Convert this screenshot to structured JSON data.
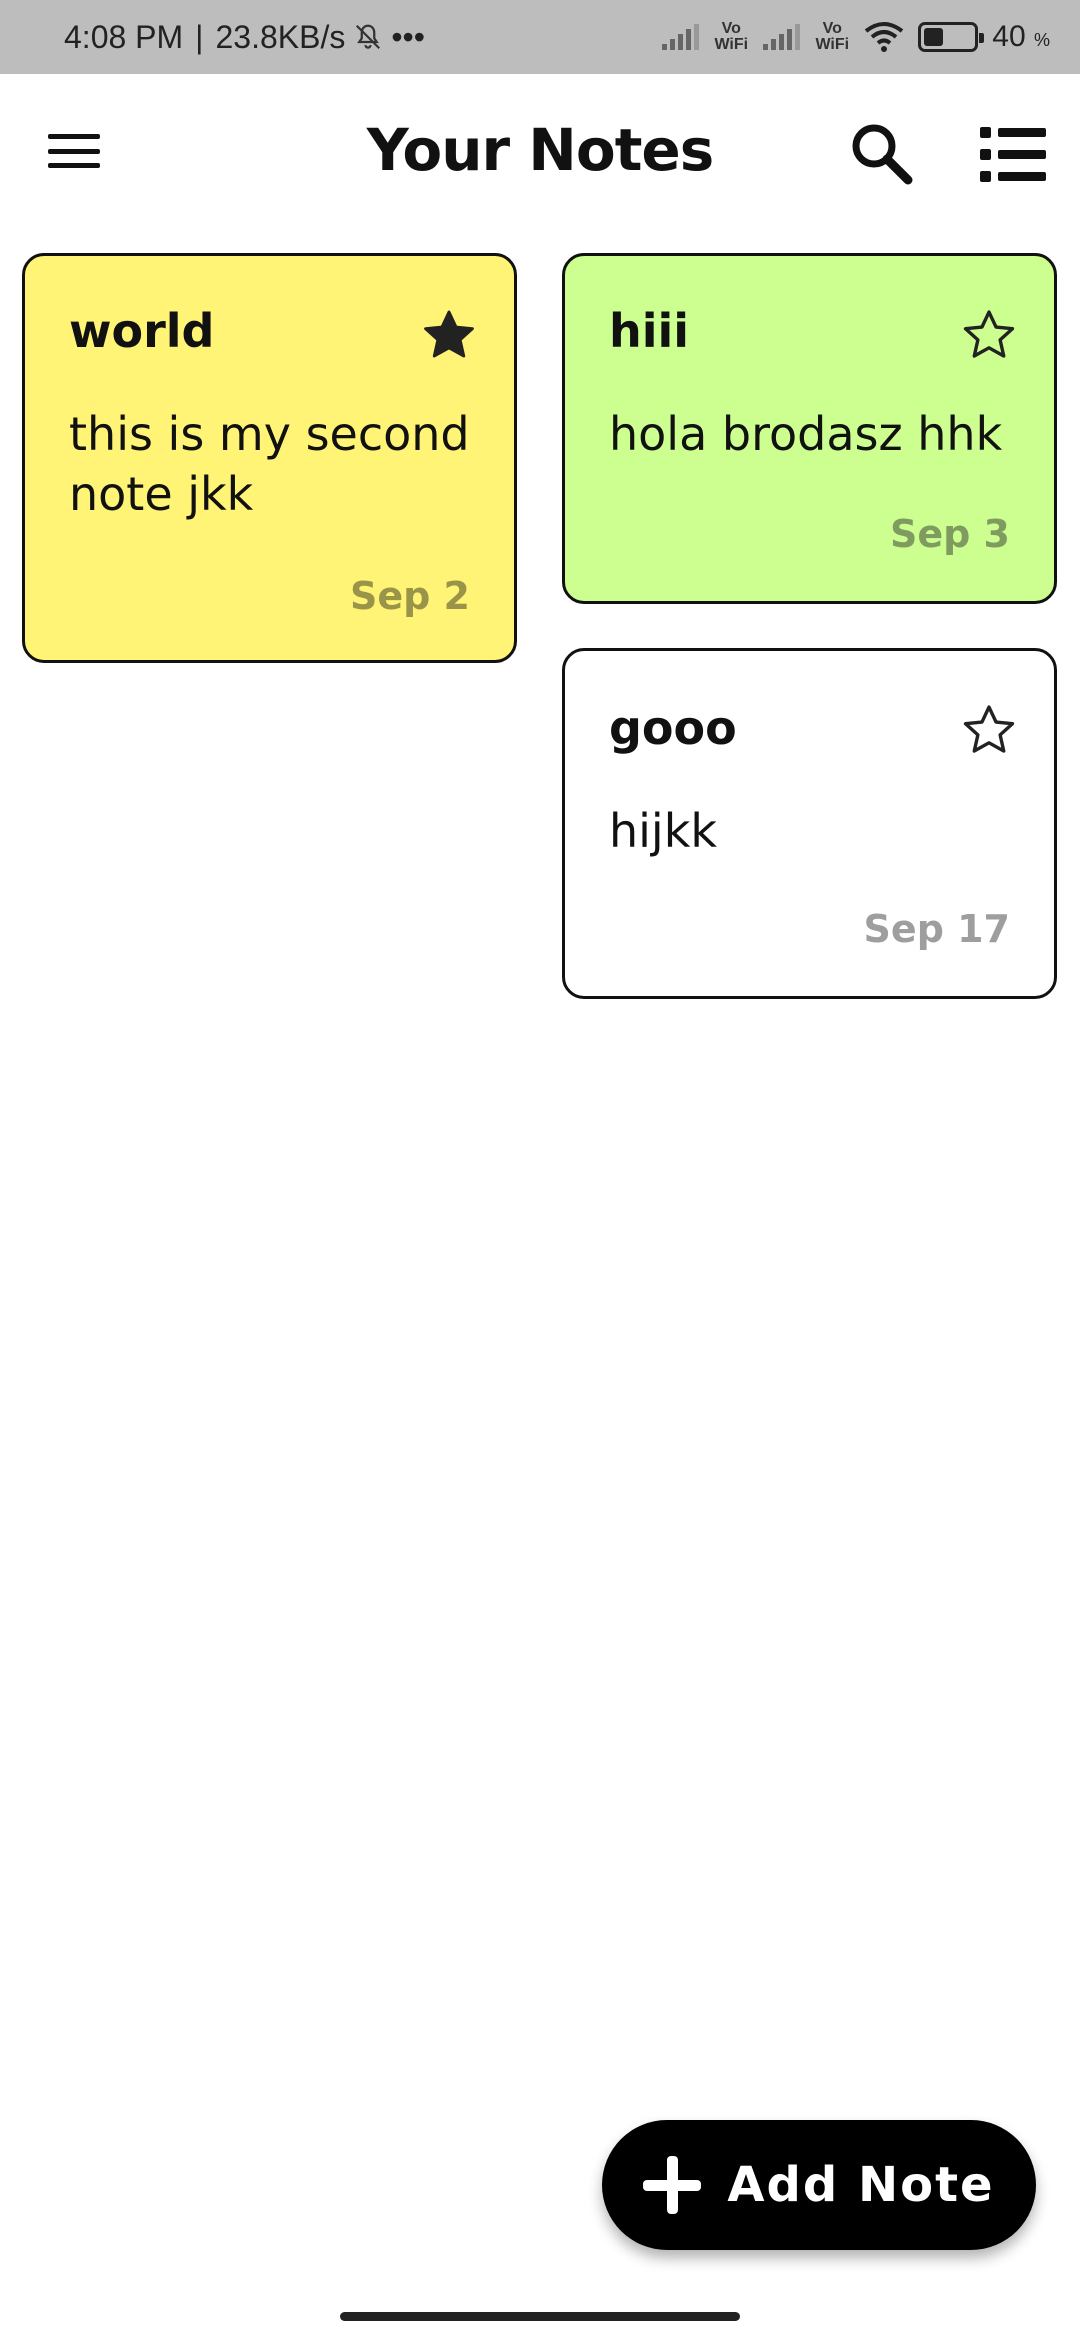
{
  "status_bar": {
    "time": "4:08 PM",
    "separator": "|",
    "net_speed": "23.8KB/s",
    "more": "•••",
    "vowifi_1": "Vo WiFi",
    "vowifi_2": "Vo WiFi",
    "battery_percent": "40",
    "percent_sign": "%",
    "battery_level": 0.4
  },
  "app_bar": {
    "title": "Your Notes",
    "menu_icon": "hamburger-menu-icon",
    "search_icon": "search-icon",
    "layout_icon": "list-view-icon"
  },
  "notes": [
    {
      "title": "world",
      "body": "this is my second note jkk",
      "date": "Sep 2",
      "starred": true,
      "color": "#fff475"
    },
    {
      "title": "hiii",
      "body": "hola brodasz hhk",
      "date": "Sep 3",
      "starred": false,
      "color": "#ccff90"
    },
    {
      "title": "gooo",
      "body": "hijkk",
      "date": "Sep 17",
      "starred": false,
      "color": "#ffffff"
    }
  ],
  "fab": {
    "label": "Add Note",
    "icon": "plus-icon"
  }
}
